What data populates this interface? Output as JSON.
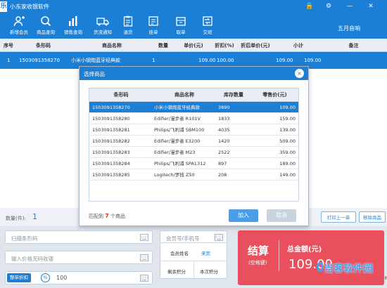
{
  "app": {
    "logo_char": "乐",
    "title": "小东家收银软件",
    "store_name": "五月音响"
  },
  "window_controls": {
    "lock": "🔒",
    "settings": "⚙",
    "minimize": "—",
    "close": "✕"
  },
  "toolbar": [
    {
      "id": "add-member",
      "label": "新增会员",
      "icon": "person-add-icon"
    },
    {
      "id": "product-query",
      "label": "商品查询",
      "icon": "search-icon"
    },
    {
      "id": "sales-query",
      "label": "销售查询",
      "icon": "bar-chart-icon"
    },
    {
      "id": "stock-transfer",
      "label": "货流通知",
      "icon": "truck-icon"
    },
    {
      "id": "return-goods",
      "label": "退货",
      "icon": "clipboard-icon"
    },
    {
      "id": "hold-order",
      "label": "挂单",
      "icon": "hold-order-icon"
    },
    {
      "id": "retrieve-order",
      "label": "取单",
      "icon": "retrieve-order-icon"
    },
    {
      "id": "shift-handover",
      "label": "交班",
      "icon": "handover-icon"
    }
  ],
  "grid": {
    "headers": [
      "序号",
      "条形码",
      "商品名称",
      "数量",
      "单价(元)",
      "折扣(%)",
      "折后单价(元)",
      "小计",
      "备注"
    ],
    "rows": [
      {
        "index": "1",
        "barcode": "1503091358270",
        "name": "小米小钢炮蓝牙经典款",
        "qty": "1",
        "price": "109.00",
        "discount": "100.00",
        "discount_price": "109.00",
        "subtotal": "109.00",
        "note": ""
      }
    ]
  },
  "modal": {
    "title": "选择商品",
    "close": "×",
    "headers": [
      "条形码",
      "商品名称",
      "库存数量",
      "零售价(元)"
    ],
    "products": [
      {
        "barcode": "1503091358270",
        "name": "小米小钢炮蓝牙经典款",
        "stock": "3890",
        "price": "109.00"
      },
      {
        "barcode": "1503091358280",
        "name": "Edifier/漫步者 R101V",
        "stock": "1833",
        "price": "159.00"
      },
      {
        "barcode": "1503091358281",
        "name": "Philips/飞利浦 SBM100",
        "stock": "4035",
        "price": "139.00"
      },
      {
        "barcode": "1503091358282",
        "name": "Edifier/漫步者 E3200",
        "stock": "1420",
        "price": "509.00"
      },
      {
        "barcode": "1503091358283",
        "name": "Edifier/漫步者 M23",
        "stock": "2522",
        "price": "359.00"
      },
      {
        "barcode": "1503091358284",
        "name": "Philips/飞利浦 SPA1312",
        "stock": "897",
        "price": "189.00"
      },
      {
        "barcode": "1503091358285",
        "name": "Logitech/罗技 Z50",
        "stock": "208",
        "price": "149.00"
      }
    ],
    "match_prefix": "匹配到",
    "match_count": "7",
    "match_suffix": "个商品",
    "add_label": "加入",
    "cancel_label": "取消"
  },
  "summary": {
    "qty_label": "数量(件):",
    "qty_value": "1",
    "print_last_label": "打印上一单",
    "remove_item_label": "移除商品"
  },
  "inputs": {
    "scan_placeholder": "扫描条形码",
    "manual_price_placeholder": "输入价格无码收银",
    "member_placeholder": "会员号/手机号",
    "discount_tag": "整单折扣",
    "discount_pct": "%",
    "discount_value": "100"
  },
  "member": {
    "name_label": "会员姓名",
    "name_value": "来宾",
    "remaining_points_label": "剩余积分",
    "current_points_label": "本次积分"
  },
  "checkout": {
    "label": "结算",
    "shortcut": "(空格键)",
    "total_label": "总金额(元)",
    "total_value": "109.00"
  },
  "watermark": {
    "text": "当客软件园",
    "sub": "www.downkr.com"
  },
  "colors": {
    "primary": "#1b7fd6",
    "checkout": "#e94f5c",
    "accent_red": "#e03030"
  }
}
